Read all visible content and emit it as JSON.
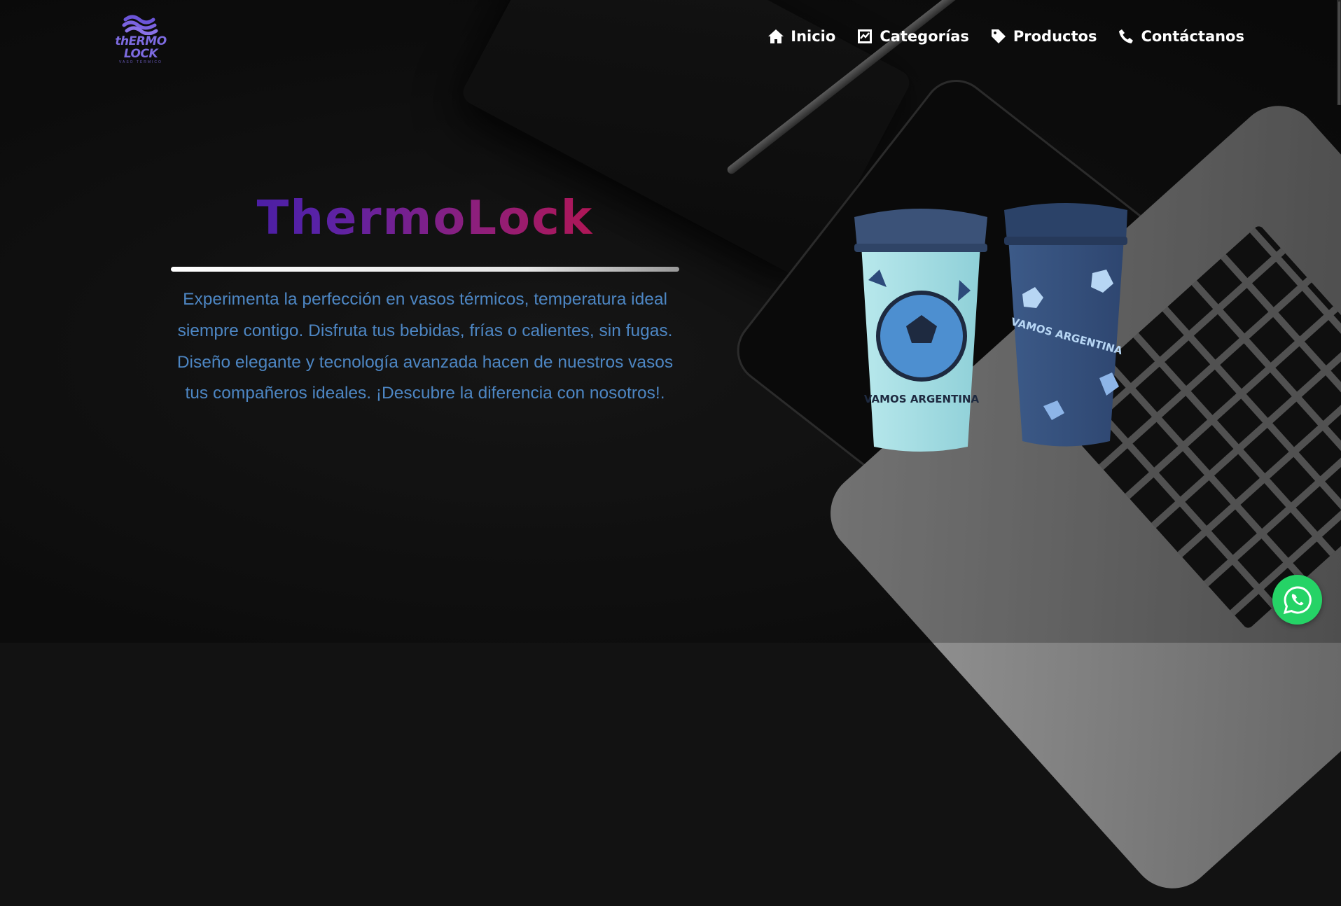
{
  "brand": {
    "logo_text": "thERMO LOCK",
    "logo_subtitle": "VASO TÉRMICO"
  },
  "nav": {
    "items": [
      {
        "label": "Inicio",
        "icon": "home-icon"
      },
      {
        "label": "Categorías",
        "icon": "chart-line-icon"
      },
      {
        "label": "Productos",
        "icon": "tag-icon"
      },
      {
        "label": "Contáctanos",
        "icon": "phone-icon"
      }
    ]
  },
  "hero": {
    "title": "ThermoLock",
    "description": "Experimenta la perfección en vasos térmicos, temperatura ideal siempre contigo. Disfruta tus bebidas, frías o calientes, sin fugas. Diseño elegante y tecnología avanzada hacen de nuestros vasos tus compañeros ideales. ¡Descubre la diferencia con nosotros!."
  },
  "cups": {
    "left_cup_text": "VAMOS ARGENTINA",
    "right_cup_text": "VAMOS ARGENTINA"
  },
  "colors": {
    "title_gradient_start": "#3a1aa0",
    "title_gradient_end": "#c8103a",
    "description": "#4d86c3",
    "whatsapp": "#25d366"
  },
  "floating": {
    "whatsapp_icon": "whatsapp-icon"
  }
}
